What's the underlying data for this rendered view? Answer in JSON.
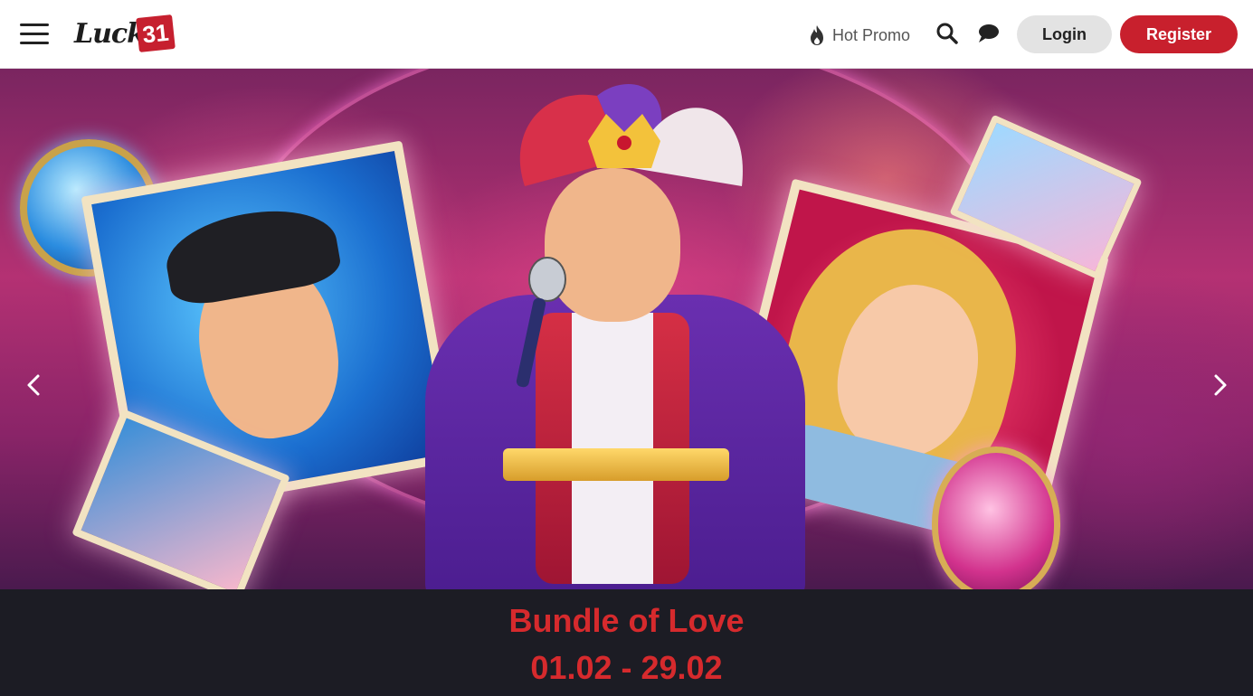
{
  "header": {
    "logo": {
      "word": "Lucky",
      "number": "31"
    },
    "hot_promo_label": "Hot Promo",
    "login_label": "Login",
    "register_label": "Register"
  },
  "banner": {
    "promo_title": "Bundle of Love",
    "promo_dates": "01.02 - 29.02"
  },
  "colors": {
    "brand_red": "#c8202d",
    "promo_text": "#d62a2d",
    "footer_bg": "#1c1c24"
  },
  "icons": [
    "menu-icon",
    "flame-icon",
    "search-icon",
    "chat-icon",
    "chevron-left-icon",
    "chevron-right-icon"
  ]
}
